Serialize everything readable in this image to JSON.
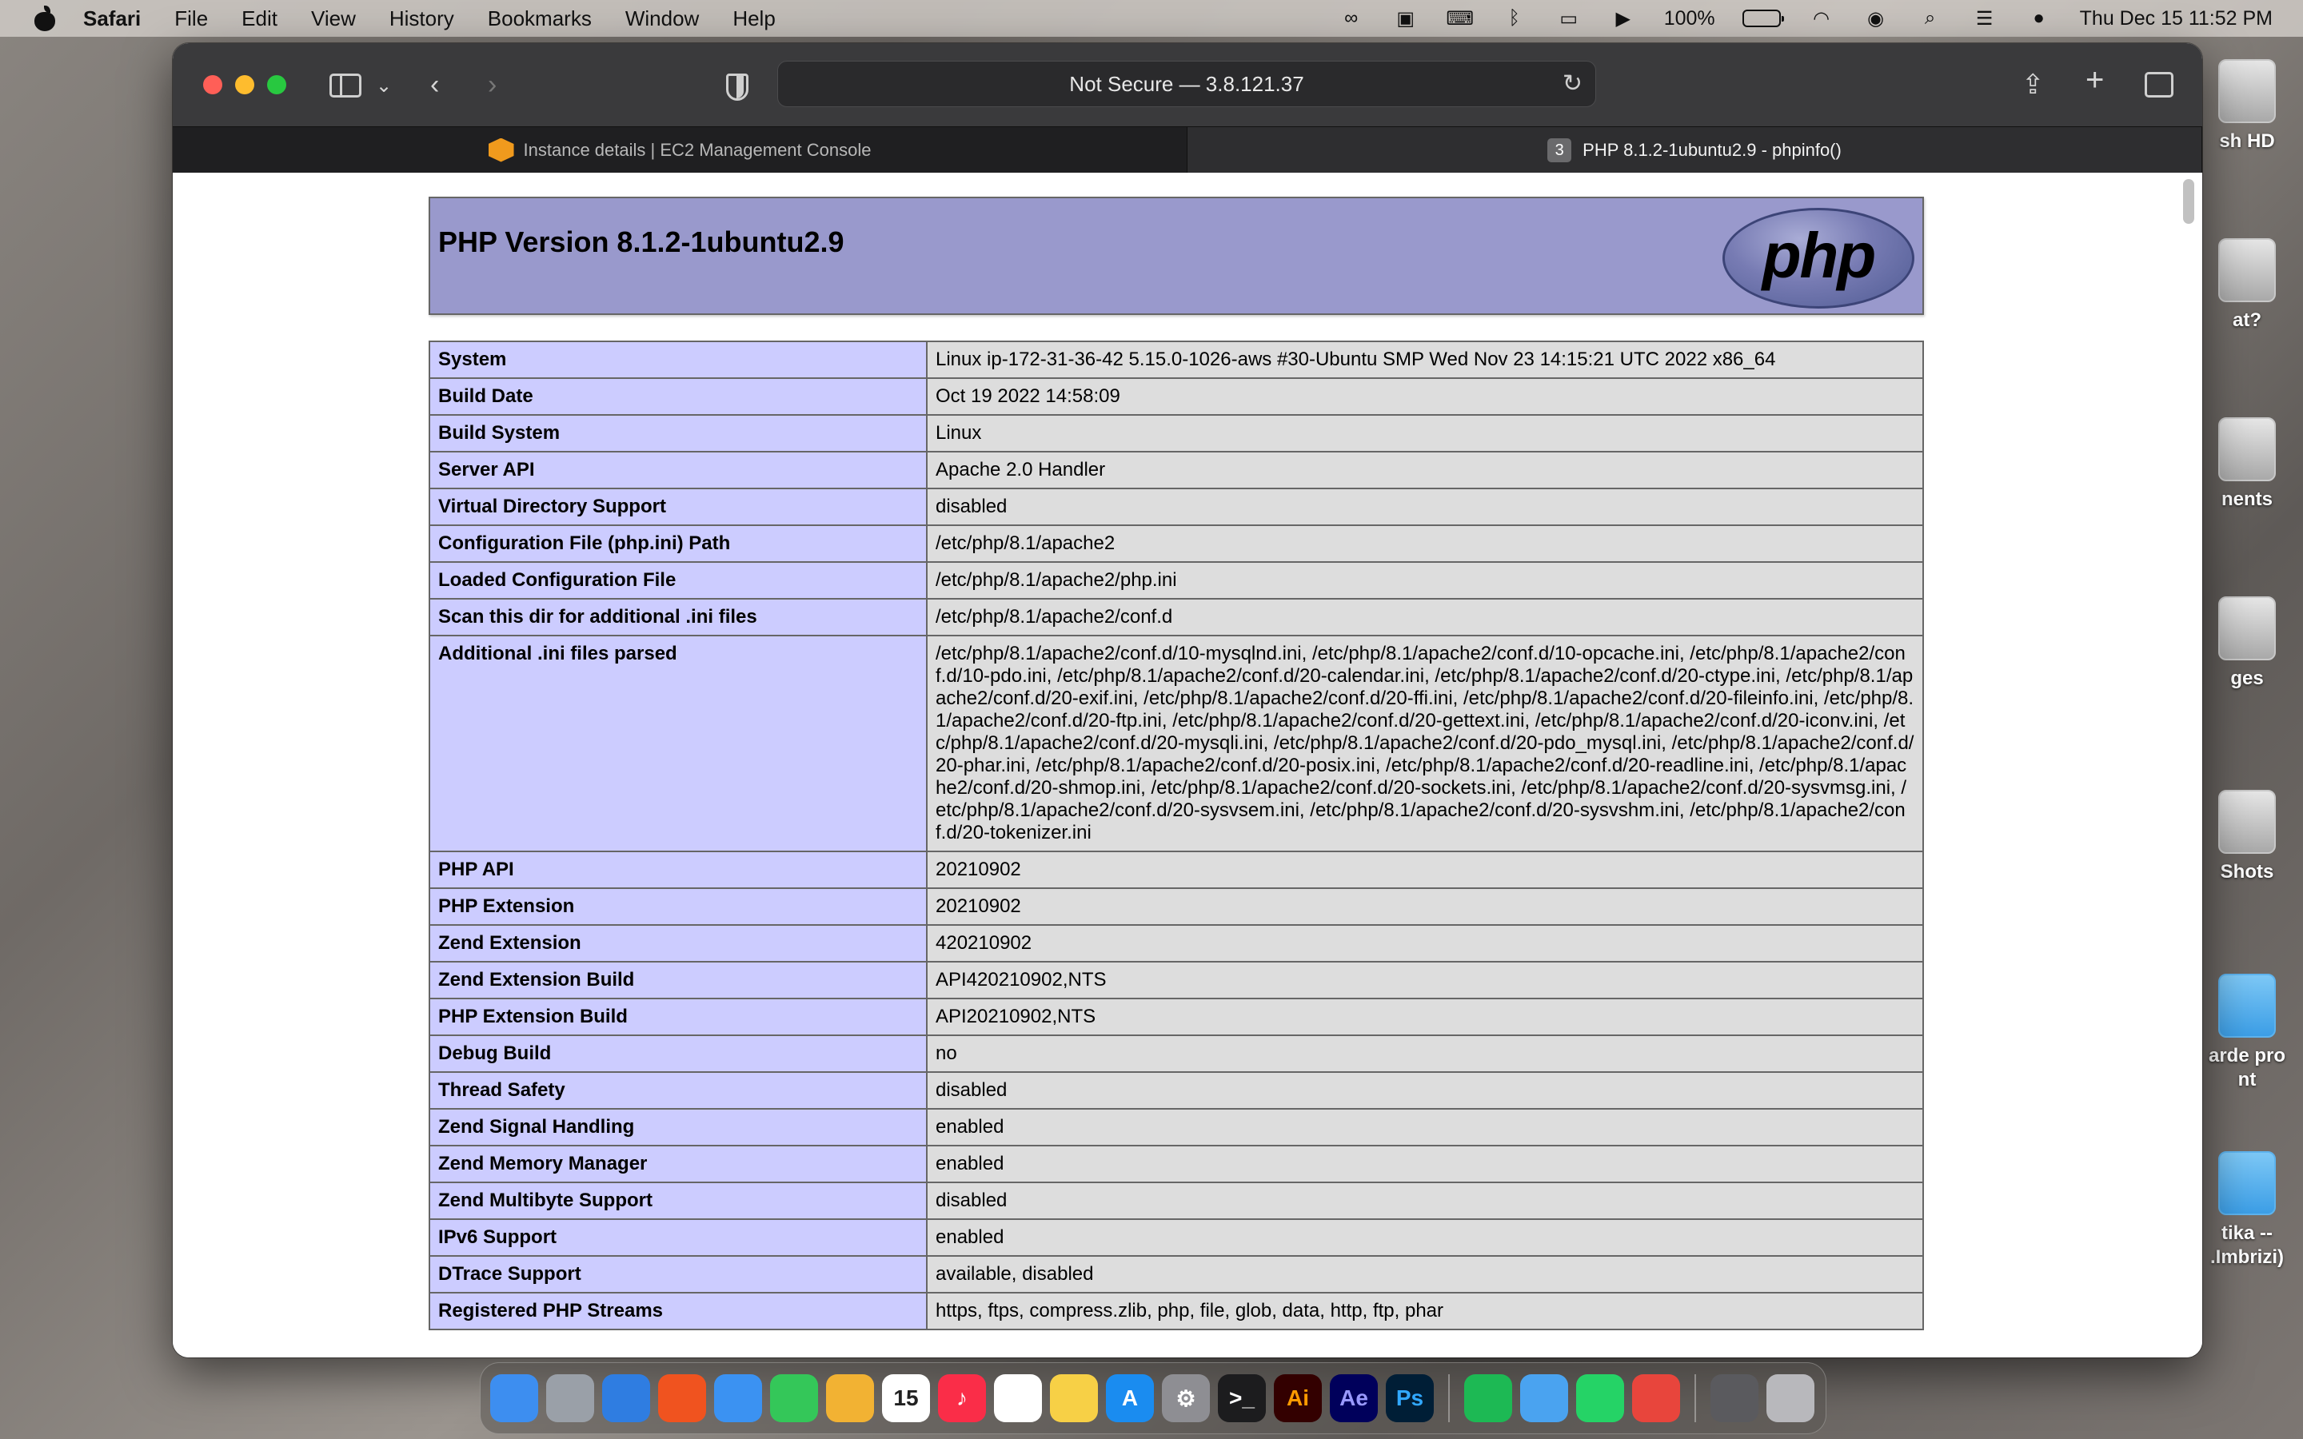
{
  "menubar": {
    "app": "Safari",
    "items": [
      "File",
      "Edit",
      "View",
      "History",
      "Bookmarks",
      "Window",
      "Help"
    ],
    "battery": "100%",
    "datetime": "Thu Dec 15  11:52 PM"
  },
  "browser": {
    "address": "Not Secure — 3.8.121.37",
    "tabs": [
      {
        "label": "Instance details | EC2 Management Console"
      },
      {
        "label": "PHP 8.1.2-1ubuntu2.9 - phpinfo()",
        "badge": "3"
      }
    ]
  },
  "phpinfo": {
    "title": "PHP Version 8.1.2-1ubuntu2.9",
    "logo_text": "php",
    "rows": [
      [
        "System",
        "Linux ip-172-31-36-42 5.15.0-1026-aws #30-Ubuntu SMP Wed Nov 23 14:15:21 UTC 2022 x86_64"
      ],
      [
        "Build Date",
        "Oct 19 2022 14:58:09"
      ],
      [
        "Build System",
        "Linux"
      ],
      [
        "Server API",
        "Apache 2.0 Handler"
      ],
      [
        "Virtual Directory Support",
        "disabled"
      ],
      [
        "Configuration File (php.ini) Path",
        "/etc/php/8.1/apache2"
      ],
      [
        "Loaded Configuration File",
        "/etc/php/8.1/apache2/php.ini"
      ],
      [
        "Scan this dir for additional .ini files",
        "/etc/php/8.1/apache2/conf.d"
      ],
      [
        "Additional .ini files parsed",
        "/etc/php/8.1/apache2/conf.d/10-mysqlnd.ini, /etc/php/8.1/apache2/conf.d/10-opcache.ini, /etc/php/8.1/apache2/conf.d/10-pdo.ini, /etc/php/8.1/apache2/conf.d/20-calendar.ini, /etc/php/8.1/apache2/conf.d/20-ctype.ini, /etc/php/8.1/apache2/conf.d/20-exif.ini, /etc/php/8.1/apache2/conf.d/20-ffi.ini, /etc/php/8.1/apache2/conf.d/20-fileinfo.ini, /etc/php/8.1/apache2/conf.d/20-ftp.ini, /etc/php/8.1/apache2/conf.d/20-gettext.ini, /etc/php/8.1/apache2/conf.d/20-iconv.ini, /etc/php/8.1/apache2/conf.d/20-mysqli.ini, /etc/php/8.1/apache2/conf.d/20-pdo_mysql.ini, /etc/php/8.1/apache2/conf.d/20-phar.ini, /etc/php/8.1/apache2/conf.d/20-posix.ini, /etc/php/8.1/apache2/conf.d/20-readline.ini, /etc/php/8.1/apache2/conf.d/20-shmop.ini, /etc/php/8.1/apache2/conf.d/20-sockets.ini, /etc/php/8.1/apache2/conf.d/20-sysvmsg.ini, /etc/php/8.1/apache2/conf.d/20-sysvsem.ini, /etc/php/8.1/apache2/conf.d/20-sysvshm.ini, /etc/php/8.1/apache2/conf.d/20-tokenizer.ini"
      ],
      [
        "PHP API",
        "20210902"
      ],
      [
        "PHP Extension",
        "20210902"
      ],
      [
        "Zend Extension",
        "420210902"
      ],
      [
        "Zend Extension Build",
        "API420210902,NTS"
      ],
      [
        "PHP Extension Build",
        "API20210902,NTS"
      ],
      [
        "Debug Build",
        "no"
      ],
      [
        "Thread Safety",
        "disabled"
      ],
      [
        "Zend Signal Handling",
        "enabled"
      ],
      [
        "Zend Memory Manager",
        "enabled"
      ],
      [
        "Zend Multibyte Support",
        "disabled"
      ],
      [
        "IPv6 Support",
        "enabled"
      ],
      [
        "DTrace Support",
        "available, disabled"
      ],
      [
        "Registered PHP Streams",
        "https, ftps, compress.zlib, php, file, glob, data, http, ftp, phar"
      ]
    ]
  },
  "desktop": {
    "items": [
      "sh HD",
      "at?",
      "nents",
      "ges",
      "Shots",
      "arde pro\nnt",
      "tika --\n.Imbrizi)"
    ]
  },
  "dock": {
    "apps": [
      {
        "name": "Finder",
        "color": "#3d8ef0",
        "glyph": ""
      },
      {
        "name": "Launchpad",
        "color": "#9aa0a8",
        "glyph": ""
      },
      {
        "name": "Safari",
        "color": "#2f7de1",
        "glyph": ""
      },
      {
        "name": "Brave",
        "color": "#f0531f",
        "glyph": ""
      },
      {
        "name": "Mail",
        "color": "#3b92f2",
        "glyph": ""
      },
      {
        "name": "FaceTime",
        "color": "#34c759",
        "glyph": ""
      },
      {
        "name": "Photos",
        "color": "#f2b233",
        "glyph": ""
      },
      {
        "name": "Calendar",
        "color": "#ffffff",
        "glyph": "15",
        "text_color": "#222"
      },
      {
        "name": "Music",
        "color": "#fa2d48",
        "glyph": "♪"
      },
      {
        "name": "Reminders",
        "color": "#ffffff",
        "glyph": "",
        "text_color": "#222"
      },
      {
        "name": "Notes",
        "color": "#f7d046",
        "glyph": ""
      },
      {
        "name": "App Store",
        "color": "#1a8cf0",
        "glyph": "A"
      },
      {
        "name": "System Settings",
        "color": "#8e8e93",
        "glyph": "⚙"
      },
      {
        "name": "Terminal",
        "color": "#1c1c1e",
        "glyph": ">_"
      },
      {
        "name": "Illustrator",
        "color": "#330000",
        "glyph": "Ai",
        "text_color": "#ff9a00"
      },
      {
        "name": "After Effects",
        "color": "#00005b",
        "glyph": "Ae",
        "text_color": "#9999ff"
      },
      {
        "name": "Photoshop",
        "color": "#001e36",
        "glyph": "Ps",
        "text_color": "#31a8ff"
      },
      {
        "name": "Spotify",
        "color": "#1db954",
        "glyph": ""
      },
      {
        "name": "Migrate",
        "color": "#4aa3f0",
        "glyph": ""
      },
      {
        "name": "WhatsApp",
        "color": "#25d366",
        "glyph": ""
      },
      {
        "name": "Chrome",
        "color": "#e8453c",
        "glyph": ""
      },
      {
        "name": "Downloads",
        "color": "#5a5a5e",
        "glyph": ""
      },
      {
        "name": "Trash",
        "color": "#b8b8bc",
        "glyph": ""
      }
    ]
  }
}
